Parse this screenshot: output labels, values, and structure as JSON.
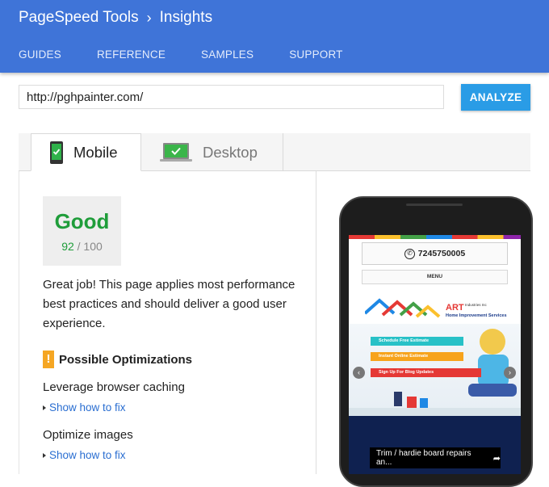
{
  "header": {
    "product": "PageSpeed Tools",
    "separator": "›",
    "page": "Insights",
    "nav": [
      "GUIDES",
      "REFERENCE",
      "SAMPLES",
      "SUPPORT"
    ]
  },
  "url_input": {
    "value": "http://pghpainter.com/"
  },
  "analyze_label": "ANALYZE",
  "tabs": [
    {
      "label": "Mobile",
      "selected": true
    },
    {
      "label": "Desktop",
      "selected": false
    }
  ],
  "score": {
    "verdict": "Good",
    "value": "92",
    "max": "/ 100"
  },
  "summary": "Great job! This page applies most performance best practices and should deliver a good user experience.",
  "optimizations": {
    "title": "Possible Optimizations",
    "icon": "!",
    "rules": [
      {
        "name": "Leverage browser caching",
        "link": "Show how to fix"
      },
      {
        "name": "Optimize images",
        "link": "Show how to fix"
      }
    ]
  },
  "preview": {
    "phone_number": "7245750005",
    "menu_label": "MENU",
    "company_line1": "Industries Inc",
    "company_line2": "Home Improvement Services",
    "ctas": [
      "Schedule Free Estimate",
      "Instant Online Estimate",
      "Sign Up For Blog Updates"
    ],
    "caption": "Trim / hardie board repairs an..."
  },
  "colors": {
    "header": "#3f74d8",
    "analyze": "#2a9ce6",
    "good": "#1f9d3a",
    "link": "#2a6ed1",
    "warning": "#f5a623"
  }
}
